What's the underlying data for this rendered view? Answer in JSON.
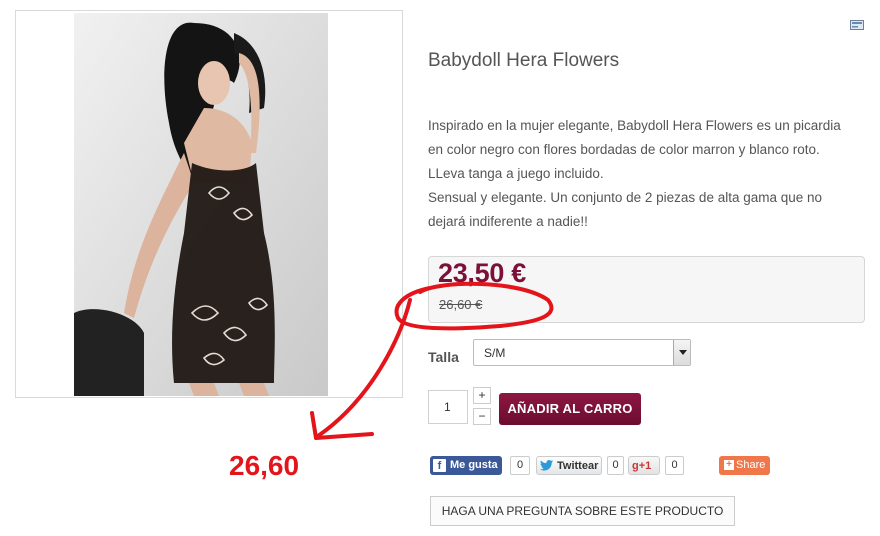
{
  "product": {
    "title": "Babydoll Hera Flowers",
    "description": [
      "Inspirado en la mujer elegante, Babydoll Hera Flowers es un picardia",
      "en color negro con flores bordadas de color marron y blanco roto.",
      "LLeva tanga a juego incluido.",
      "Sensual y elegante. Un conjunto de 2 piezas de alta gama que no",
      "dejará indiferente a nadie!!"
    ],
    "price": "23,50 €",
    "old_price": "26,60 €",
    "image_icon": "product-photo"
  },
  "options": {
    "size_label": "Talla",
    "size_selected": "S/M"
  },
  "cart": {
    "quantity": "1",
    "plus": "+",
    "minus": "−",
    "add_label": "AÑADIR AL CARRO"
  },
  "social": {
    "facebook_label": "Me gusta",
    "facebook_count": "0",
    "twitter_label": "Twittear",
    "twitter_count": "0",
    "gplus_label": "+1",
    "gplus_count": "0",
    "share_label": "Share"
  },
  "question_button": "HAGA UNA PREGUNTA SOBRE ESTE PRODUCTO",
  "annotation": {
    "text": "26,60",
    "color": "#e4141b"
  },
  "colors": {
    "price": "#7b1038",
    "cart_button": "#7a1036",
    "facebook": "#3b5998",
    "share": "#f0774a"
  }
}
